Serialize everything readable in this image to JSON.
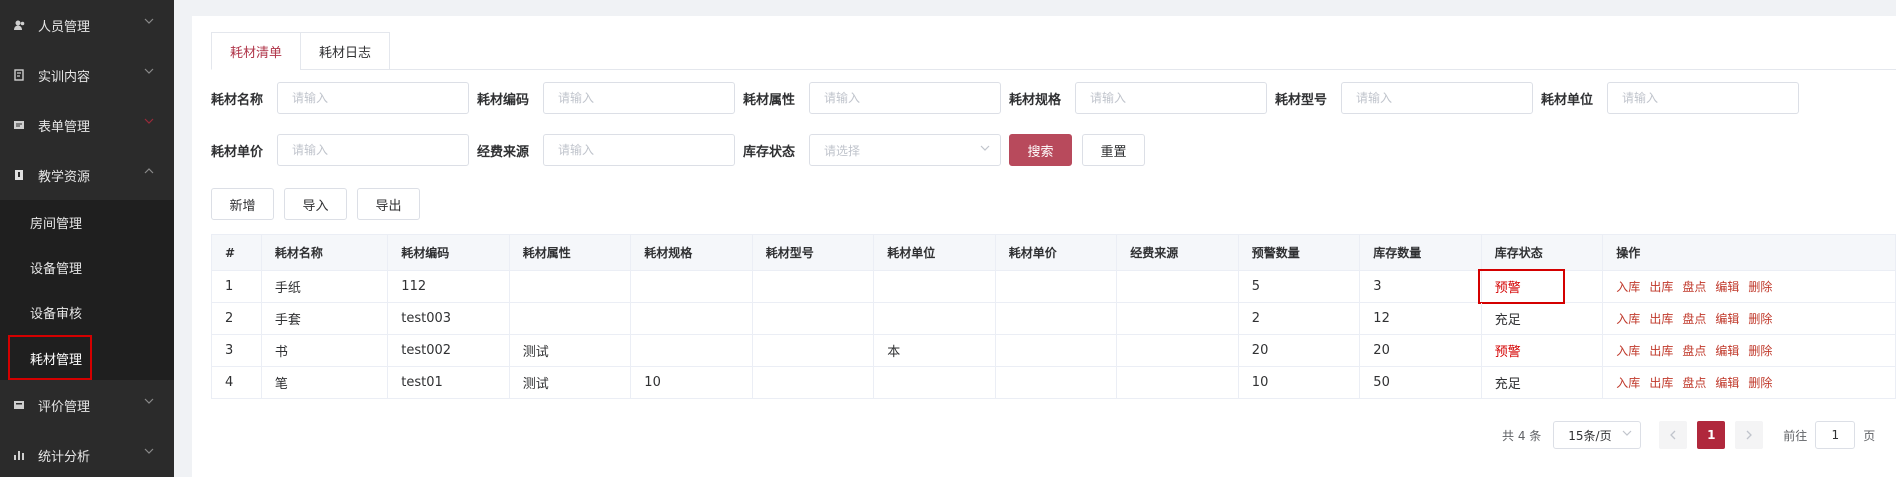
{
  "sidebar": {
    "items": [
      {
        "label": "人员管理",
        "icon": "user-icon"
      },
      {
        "label": "实训内容",
        "icon": "document-icon"
      },
      {
        "label": "表单管理",
        "icon": "form-icon"
      },
      {
        "label": "教学资源",
        "icon": "resource-icon"
      },
      {
        "label": "评价管理",
        "icon": "evaluation-icon"
      },
      {
        "label": "统计分析",
        "icon": "chart-icon"
      }
    ],
    "submenu": [
      "房间管理",
      "设备管理",
      "设备审核",
      "耗材管理"
    ]
  },
  "tabs": [
    "耗材清单",
    "耗材日志"
  ],
  "filters": {
    "row1": [
      {
        "label": "耗材名称",
        "placeholder": "请输入"
      },
      {
        "label": "耗材编码",
        "placeholder": "请输入"
      },
      {
        "label": "耗材属性",
        "placeholder": "请输入"
      },
      {
        "label": "耗材规格",
        "placeholder": "请输入"
      },
      {
        "label": "耗材型号",
        "placeholder": "请输入"
      },
      {
        "label": "耗材单位",
        "placeholder": "请输入"
      }
    ],
    "row2": [
      {
        "label": "耗材单价",
        "placeholder": "请输入"
      },
      {
        "label": "经费来源",
        "placeholder": "请输入"
      }
    ],
    "stock_status": {
      "label": "库存状态",
      "placeholder": "请选择"
    },
    "search_label": "搜索",
    "reset_label": "重置"
  },
  "toolbar": {
    "add_label": "新增",
    "import_label": "导入",
    "export_label": "导出"
  },
  "table": {
    "headers": [
      "#",
      "耗材名称",
      "耗材编码",
      "耗材属性",
      "耗材规格",
      "耗材型号",
      "耗材单位",
      "耗材单价",
      "经费来源",
      "预警数量",
      "库存数量",
      "库存状态",
      "操作"
    ],
    "rows": [
      [
        "1",
        "手纸",
        "112",
        "",
        "",
        "",
        "",
        "",
        "",
        "5",
        "3",
        "预警"
      ],
      [
        "2",
        "手套",
        "test003",
        "",
        "",
        "",
        "",
        "",
        "",
        "2",
        "12",
        "充足"
      ],
      [
        "3",
        "书",
        "test002",
        "测试",
        "",
        "",
        "本",
        "",
        "",
        "20",
        "20",
        "预警"
      ],
      [
        "4",
        "笔",
        "test01",
        "测试",
        "10",
        "",
        "",
        "",
        "",
        "10",
        "50",
        "充足"
      ]
    ],
    "ops": [
      "入库",
      "出库",
      "盘点",
      "编辑",
      "删除"
    ],
    "warn_color": "#d40000"
  },
  "pagination": {
    "total": "共 4 条",
    "page_size": "15条/页",
    "current_page": "1",
    "goto_prefix": "前往",
    "goto_value": "1",
    "goto_suffix": "页"
  },
  "colors": {
    "accent": "#b0283c",
    "sidebar_bg": "#2b2b2b",
    "highlight": "#d40000"
  }
}
